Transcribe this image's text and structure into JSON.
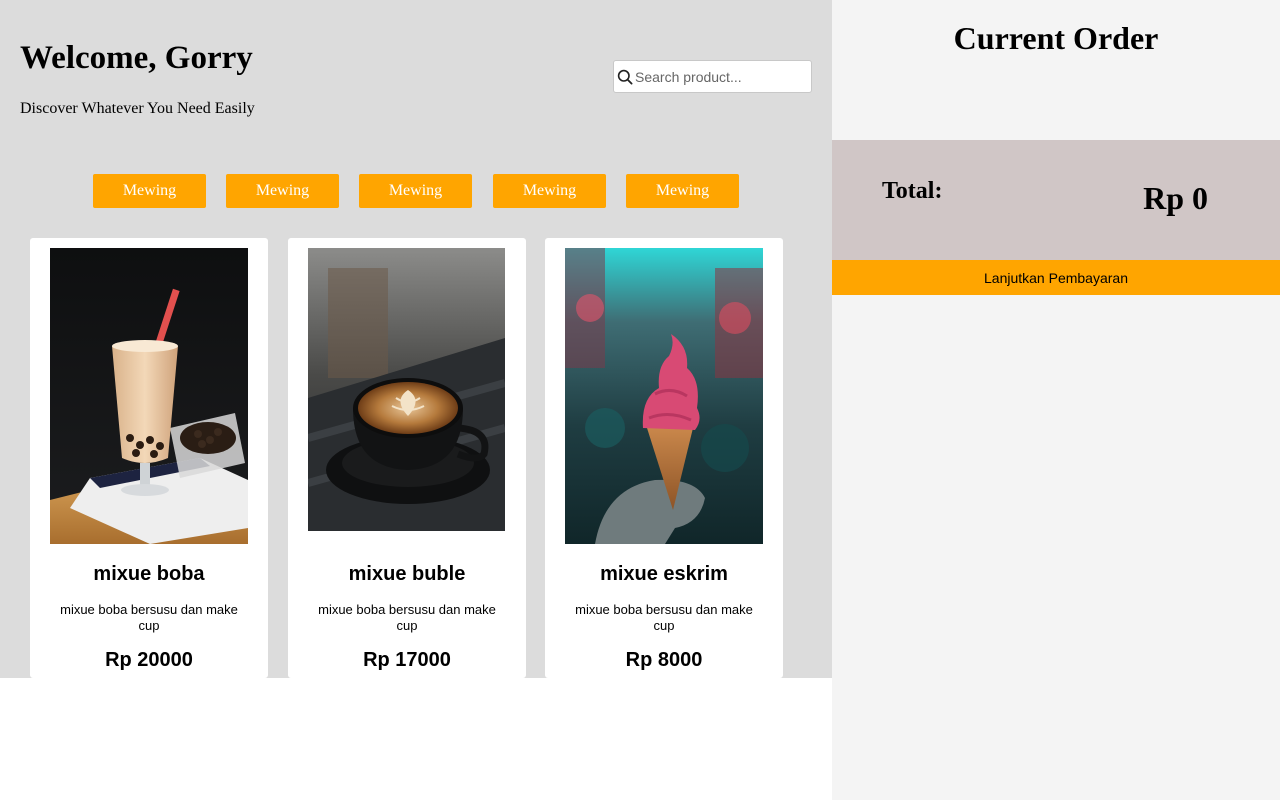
{
  "header": {
    "welcome": "Welcome, Gorry",
    "subtitle": "Discover Whatever You Need Easily"
  },
  "search": {
    "icon": "search-icon",
    "placeholder": "Search product..."
  },
  "categories": [
    "Mewing",
    "Mewing",
    "Mewing",
    "Mewing",
    "Mewing"
  ],
  "products": [
    {
      "name": "mixue boba",
      "description": "mixue boba bersusu dan make cup",
      "price": "Rp 20000",
      "image": "boba-drink-photo"
    },
    {
      "name": "mixue buble",
      "description": "mixue boba bersusu dan make cup",
      "price": "Rp 17000",
      "image": "latte-coffee-photo"
    },
    {
      "name": "mixue eskrim",
      "description": "mixue boba bersusu dan make cup",
      "price": "Rp 8000",
      "image": "ice-cream-cone-photo"
    }
  ],
  "order": {
    "title": "Current Order",
    "total_label": "Total:",
    "total_value": "Rp 0",
    "pay_button": "Lanjutkan Pembayaran"
  },
  "colors": {
    "accent": "#ffa500",
    "main_bg": "#dcdcdc",
    "side_bg": "#f4f4f4",
    "total_bg": "#d0c6c6"
  }
}
